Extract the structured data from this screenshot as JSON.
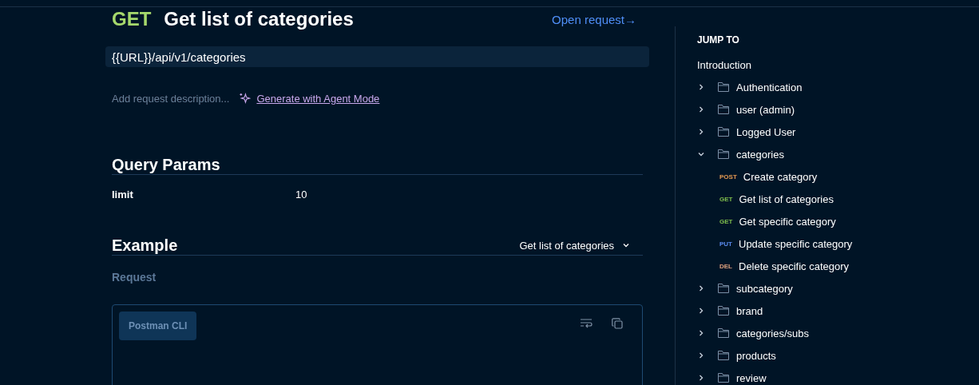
{
  "request": {
    "method": "GET",
    "title": "Get list of categories",
    "open_link": "Open request→",
    "url": "{{URL}}/api/v1/categories",
    "description_placeholder": "Add request description...",
    "agent_link": "Generate with Agent Mode"
  },
  "query_params": {
    "heading": "Query Params",
    "rows": [
      {
        "key": "limit",
        "value": "10"
      }
    ]
  },
  "example": {
    "heading": "Example",
    "selector": "Get list of categories",
    "subheading": "Request",
    "tabs": [
      {
        "label": "Postman CLI",
        "selected": true
      }
    ]
  },
  "sidebar": {
    "heading": "JUMP TO",
    "items": [
      {
        "kind": "link",
        "label": "Introduction"
      },
      {
        "kind": "folder",
        "label": "Authentication",
        "expanded": false
      },
      {
        "kind": "folder",
        "label": "user (admin)",
        "expanded": false
      },
      {
        "kind": "folder",
        "label": "Logged User",
        "expanded": false
      },
      {
        "kind": "folder",
        "label": "categories",
        "expanded": true,
        "children": [
          {
            "method": "POST",
            "label": "Create category",
            "color": "#e49a52"
          },
          {
            "method": "GET",
            "label": "Get list of categories",
            "color": "#7fbf4d"
          },
          {
            "method": "GET",
            "label": "Get specific category",
            "color": "#7fbf4d"
          },
          {
            "method": "PUT",
            "label": "Update specific category",
            "color": "#5b8cf0"
          },
          {
            "method": "DEL",
            "label": "Delete specific category",
            "color": "#e0a07e"
          }
        ]
      },
      {
        "kind": "folder",
        "label": "subcategory",
        "expanded": false
      },
      {
        "kind": "folder",
        "label": "brand",
        "expanded": false
      },
      {
        "kind": "folder",
        "label": "categories/subs",
        "expanded": false
      },
      {
        "kind": "folder",
        "label": "products",
        "expanded": false
      },
      {
        "kind": "folder",
        "label": "review",
        "expanded": false
      }
    ]
  }
}
